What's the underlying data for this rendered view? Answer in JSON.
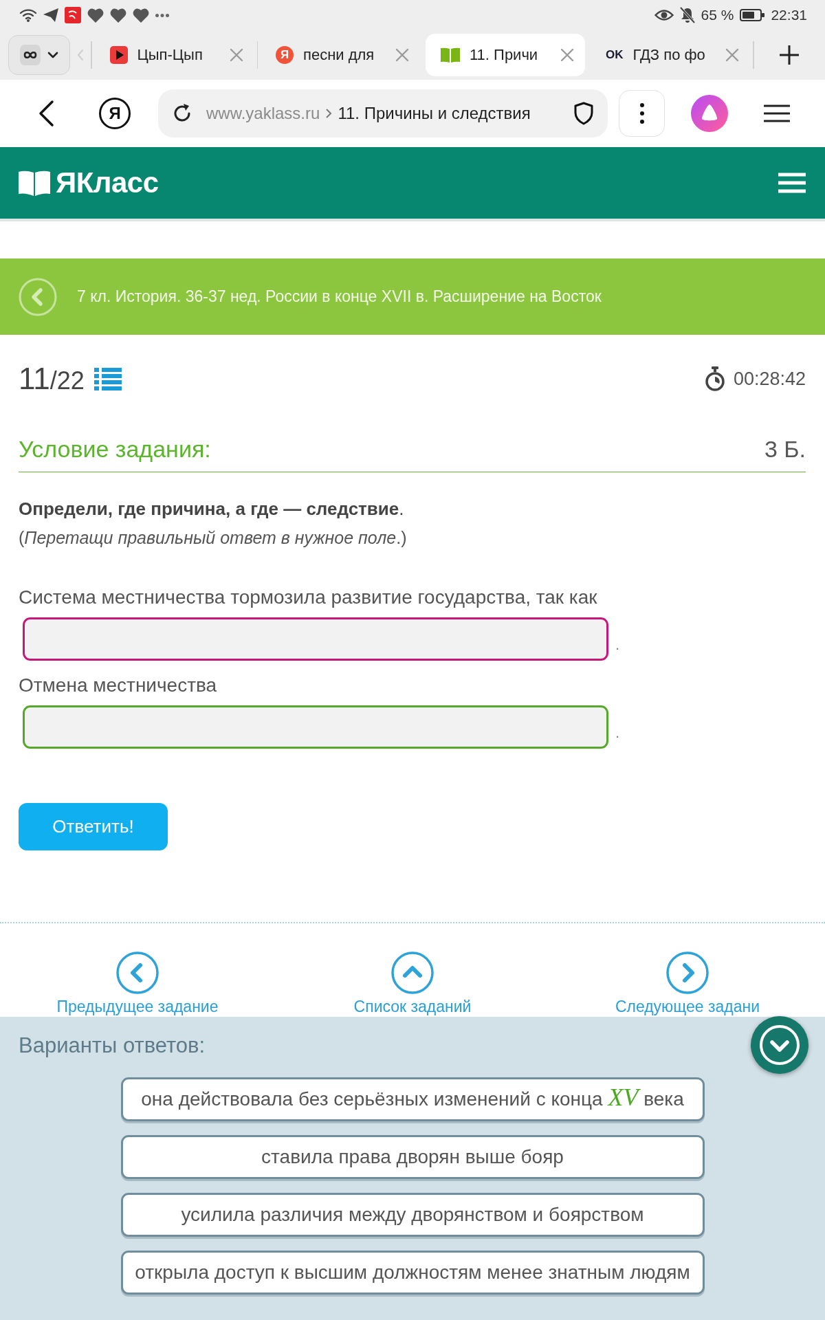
{
  "status_bar": {
    "battery_percent": "65 %",
    "time": "22:31"
  },
  "tabs": [
    {
      "kind": "video",
      "title": "Цып-Цып",
      "selected": false
    },
    {
      "kind": "yandex",
      "favicon_text": "Я",
      "title": "песни для",
      "selected": false
    },
    {
      "kind": "book",
      "title": "11. Причи",
      "selected": true
    },
    {
      "kind": "ok",
      "favicon_text": "OK",
      "title": "ГДЗ по фо",
      "selected": false
    }
  ],
  "address_bar": {
    "logo_button": "Я",
    "domain": "www.yaklass.ru",
    "page_title": "11. Причины и следствия"
  },
  "site_header": {
    "logo": "ЯКласс"
  },
  "breadcrumb": {
    "text": "7 кл. История. 36-37 нед. России в конце XVII в. Расширение на Восток"
  },
  "task": {
    "current": "11",
    "of_total": "/22",
    "timer": "00:28:42",
    "heading": "Условие задания:",
    "points": "3 Б.",
    "instruction": "**Определи, где причина, а где — следствие**.",
    "hint": "(*Перетащи правильный ответ в нужное поле*.)",
    "blanks": [
      {
        "label": "Система местничества тормозила развитие государства, так как",
        "color": "#c8177a",
        "suffix": "."
      },
      {
        "label": "Отмена местничества",
        "color": "#55a82a",
        "suffix": "."
      }
    ],
    "submit_button": "Ответить!"
  },
  "navigation": [
    {
      "kind": "prev",
      "label": "Предыдущее задание"
    },
    {
      "kind": "list",
      "label": "Список заданий"
    },
    {
      "kind": "next",
      "label": "Следующее задани"
    }
  ],
  "answers": {
    "title": "Варианты ответов:",
    "options": [
      "она действовала без серьёзных изменений с конца *XV* века",
      "ставила права дворян выше бояр",
      "усилила различия между дворянством и боярством",
      "открыла доступ к высшим должностям менее знатным людям"
    ]
  }
}
